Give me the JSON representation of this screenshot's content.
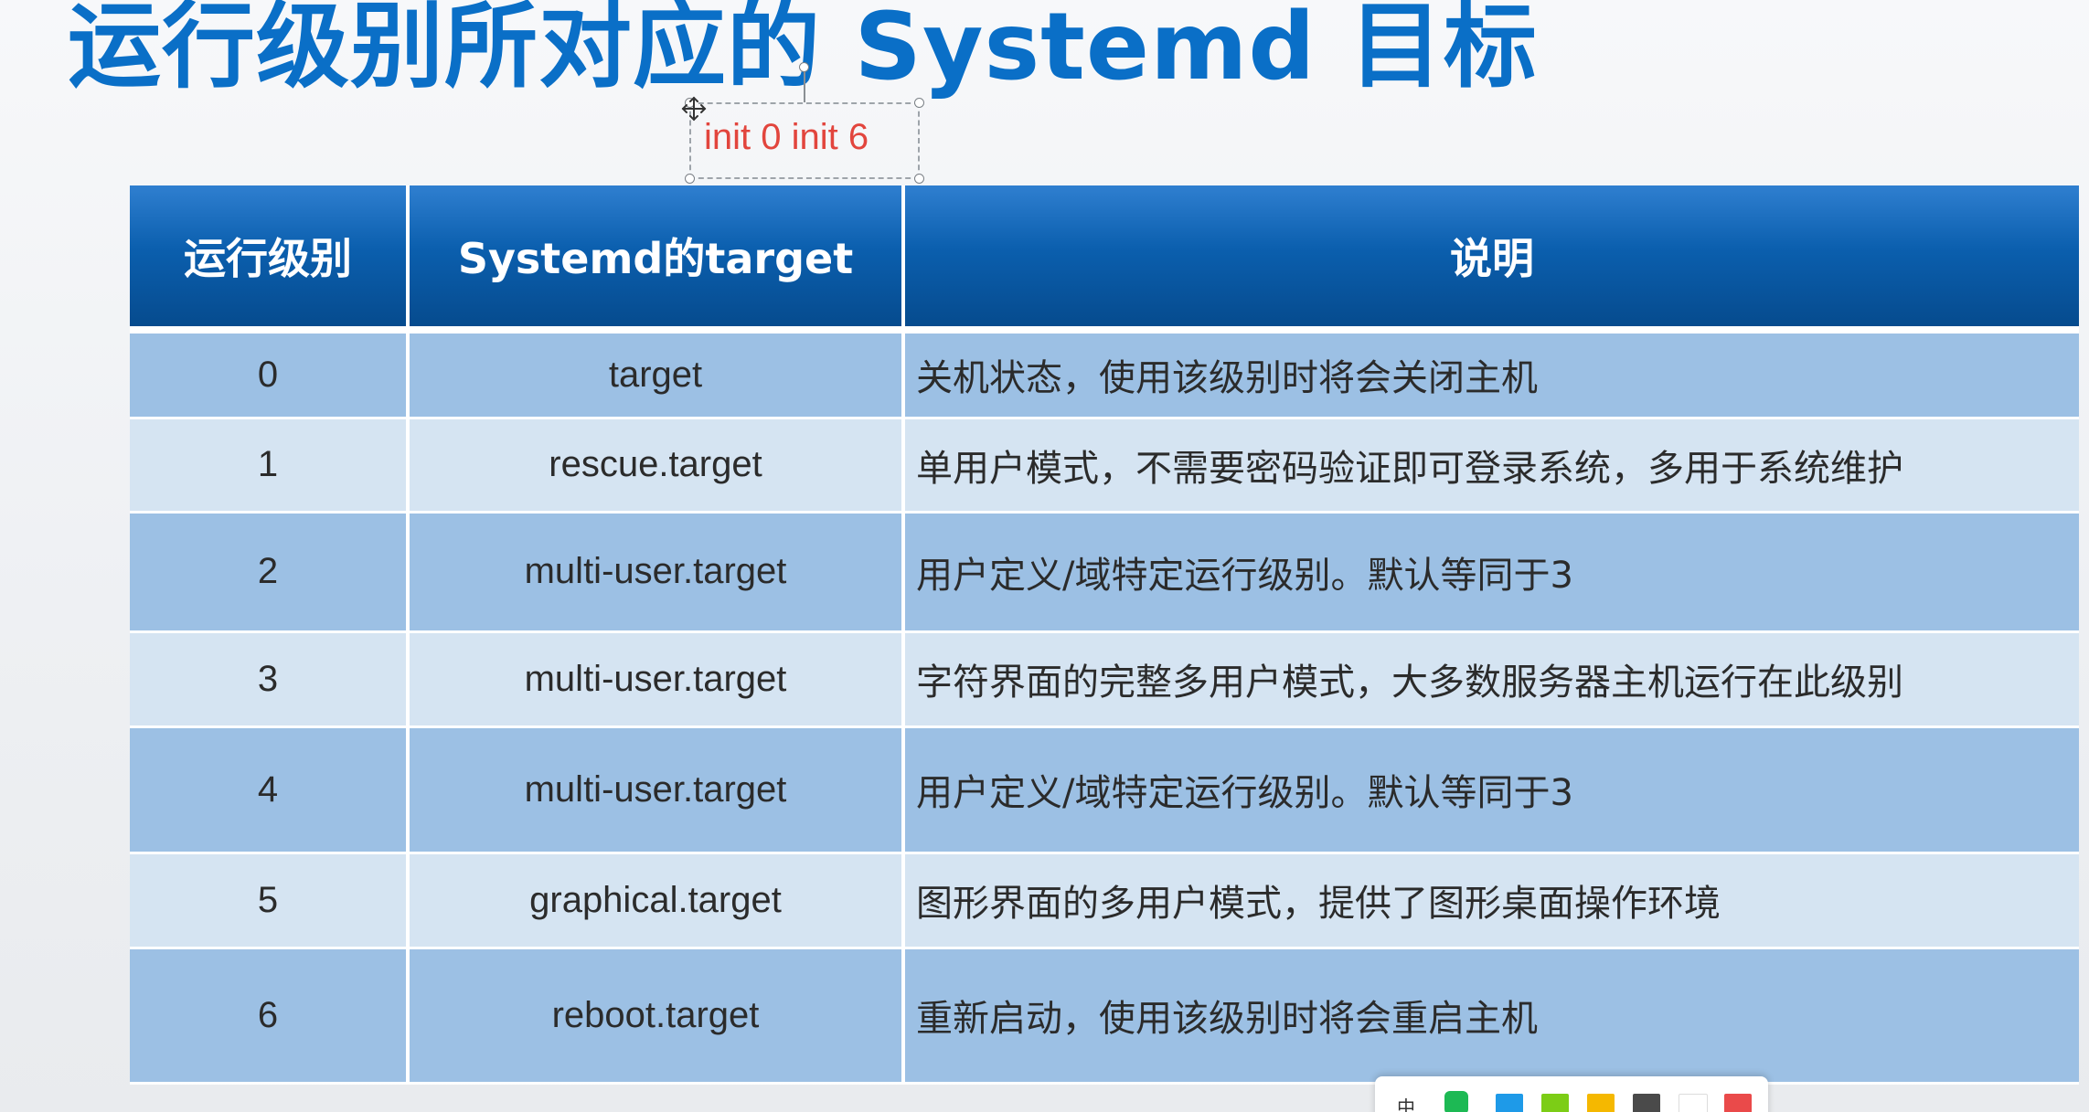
{
  "title": "运行级别所对应的 Systemd 目标",
  "annotation": {
    "text": "init 0  init 6",
    "color": "#e2453d"
  },
  "table": {
    "headers": [
      "运行级别",
      "Systemd的target",
      "说明"
    ],
    "rows": [
      {
        "level": "0",
        "target": "target",
        "desc": "关机状态，使用该级别时将会关闭主机"
      },
      {
        "level": "1",
        "target": "rescue.target",
        "desc": "单用户模式，不需要密码验证即可登录系统，多用于系统维护"
      },
      {
        "level": "2",
        "target": "multi-user.target",
        "desc": "用户定义/域特定运行级别。默认等同于3"
      },
      {
        "level": "3",
        "target": "multi-user.target",
        "desc": "字符界面的完整多用户模式，大多数服务器主机运行在此级别"
      },
      {
        "level": "4",
        "target": "multi-user.target",
        "desc": "用户定义/域特定运行级别。默认等同于3"
      },
      {
        "level": "5",
        "target": "graphical.target",
        "desc": "图形界面的多用户模式，提供了图形桌面操作环境"
      },
      {
        "level": "6",
        "target": "reboot.target",
        "desc": "重新启动，使用该级别时将会重启主机"
      }
    ]
  },
  "toolbar": {
    "ime_label": "中",
    "toggle_icon": "switch-icon",
    "swatches": [
      "#1e9ae8",
      "#7ccd16",
      "#f5b800",
      "#4a4a4a",
      "#ffffff",
      "#ea4a4a"
    ]
  },
  "colors": {
    "title": "#0a6fc7",
    "header_bg": "#0b5fae",
    "row_dark": "#9cc0e4",
    "row_light": "#d5e4f2"
  }
}
